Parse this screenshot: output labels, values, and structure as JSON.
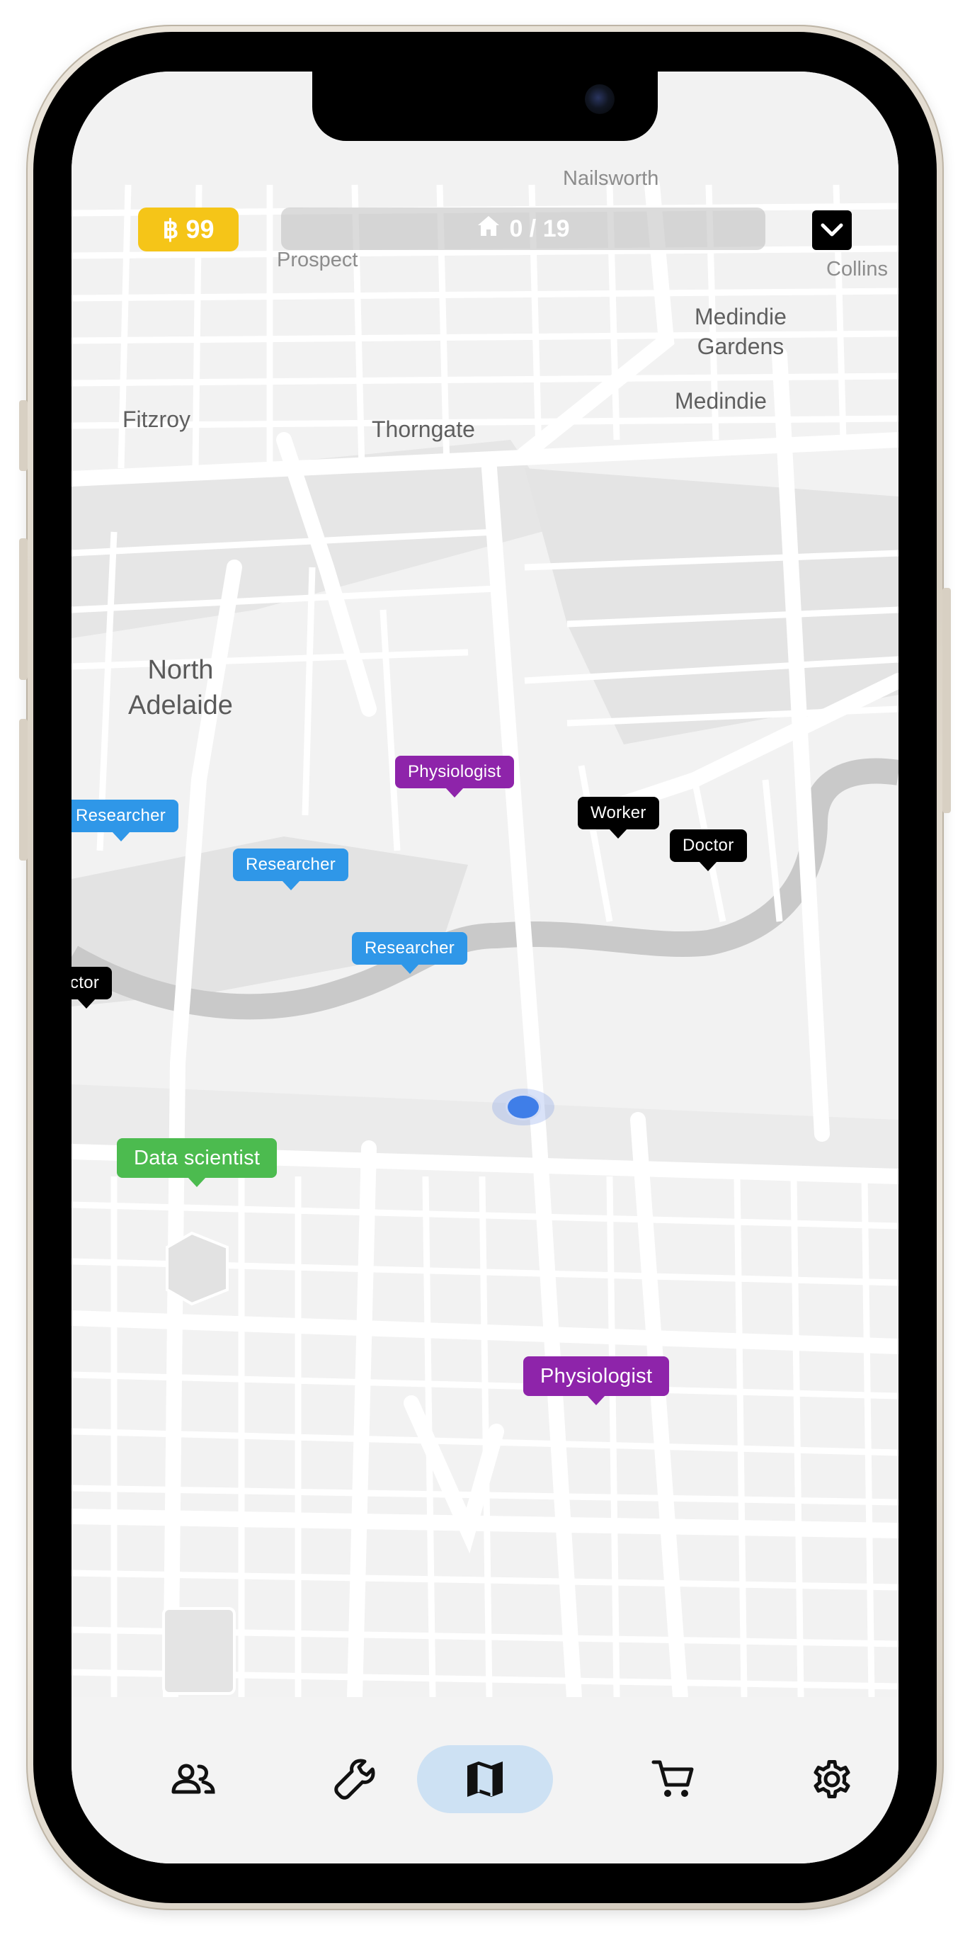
{
  "header": {
    "coin_symbol": "฿",
    "coin_value": "99",
    "progress_text": "0 / 19",
    "progress_fraction": 0.0
  },
  "map": {
    "places": {
      "nailsworth": "Nailsworth",
      "prospect": "Prospect",
      "collins": "Collins",
      "medindie_gardens": "Medindie\nGardens",
      "medindie": "Medindie",
      "fitzroy": "Fitzroy",
      "thorngate": "Thorngate",
      "north_adelaide": "North\nAdelaide"
    },
    "markers": [
      {
        "label": "Physiologist",
        "color": "#8e24aa"
      },
      {
        "label": "Researcher",
        "color": "#2f97e8"
      },
      {
        "label": "Worker",
        "color": "#000000"
      },
      {
        "label": "Doctor",
        "color": "#000000"
      },
      {
        "label": "Researcher",
        "color": "#2f97e8"
      },
      {
        "label": "Researcher",
        "color": "#2f97e8"
      },
      {
        "label": "ctor",
        "color": "#000000"
      },
      {
        "label": "Data scientist",
        "color": "#4cbb4f"
      },
      {
        "label": "Physiologist",
        "color": "#8e24aa"
      }
    ]
  },
  "nav": {
    "items": [
      {
        "icon": "people-icon",
        "label": "People"
      },
      {
        "icon": "wrench-icon",
        "label": "Tools"
      },
      {
        "icon": "map-icon",
        "label": "Map"
      },
      {
        "icon": "cart-icon",
        "label": "Shop"
      },
      {
        "icon": "gear-icon",
        "label": "Settings"
      }
    ],
    "active_index": 2
  },
  "colors": {
    "coin": "#f5c518",
    "nav_active": "#cde1f3",
    "user_location": "#3f7ee8"
  }
}
